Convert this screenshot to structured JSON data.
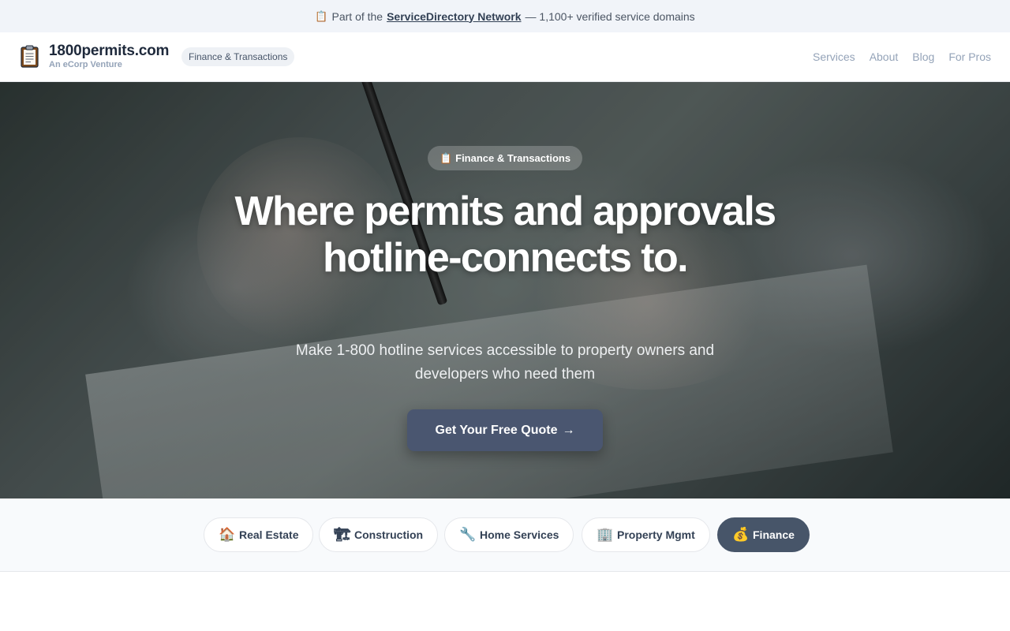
{
  "topbar": {
    "prefix": "Part of the",
    "link": "ServiceDirectory Network",
    "suffix": "— 1,100+ verified service domains"
  },
  "header": {
    "brand_name": "1800permits.com",
    "brand_sub": "An eCorp Venture",
    "category_pill": "Finance & Transactions",
    "nav": [
      "Services",
      "About",
      "Blog",
      "For Pros"
    ]
  },
  "hero": {
    "pill": "Finance & Transactions",
    "title": "Where permits and approvals hotline-connects to.",
    "subtitle": "Make 1-800 hotline services accessible to property owners and developers who need them",
    "cta": "Get Your Free Quote",
    "cta_arrow": "→"
  },
  "categories": [
    {
      "label": "Real Estate",
      "icon": "house-icon",
      "glyph": "🏠",
      "active": false
    },
    {
      "label": "Construction",
      "icon": "construction-icon",
      "glyph": "🏗",
      "active": false
    },
    {
      "label": "Home Services",
      "icon": "wrench-icon",
      "glyph": "🔧",
      "active": false
    },
    {
      "label": "Property Mgmt",
      "icon": "building-icon",
      "glyph": "🏢",
      "active": false
    },
    {
      "label": "Finance",
      "icon": "money-bag-icon",
      "glyph": "💰",
      "active": true
    }
  ],
  "colors": {
    "accent": "#475569",
    "cta": "#4a5670",
    "topbar_bg": "#f1f4f9"
  }
}
